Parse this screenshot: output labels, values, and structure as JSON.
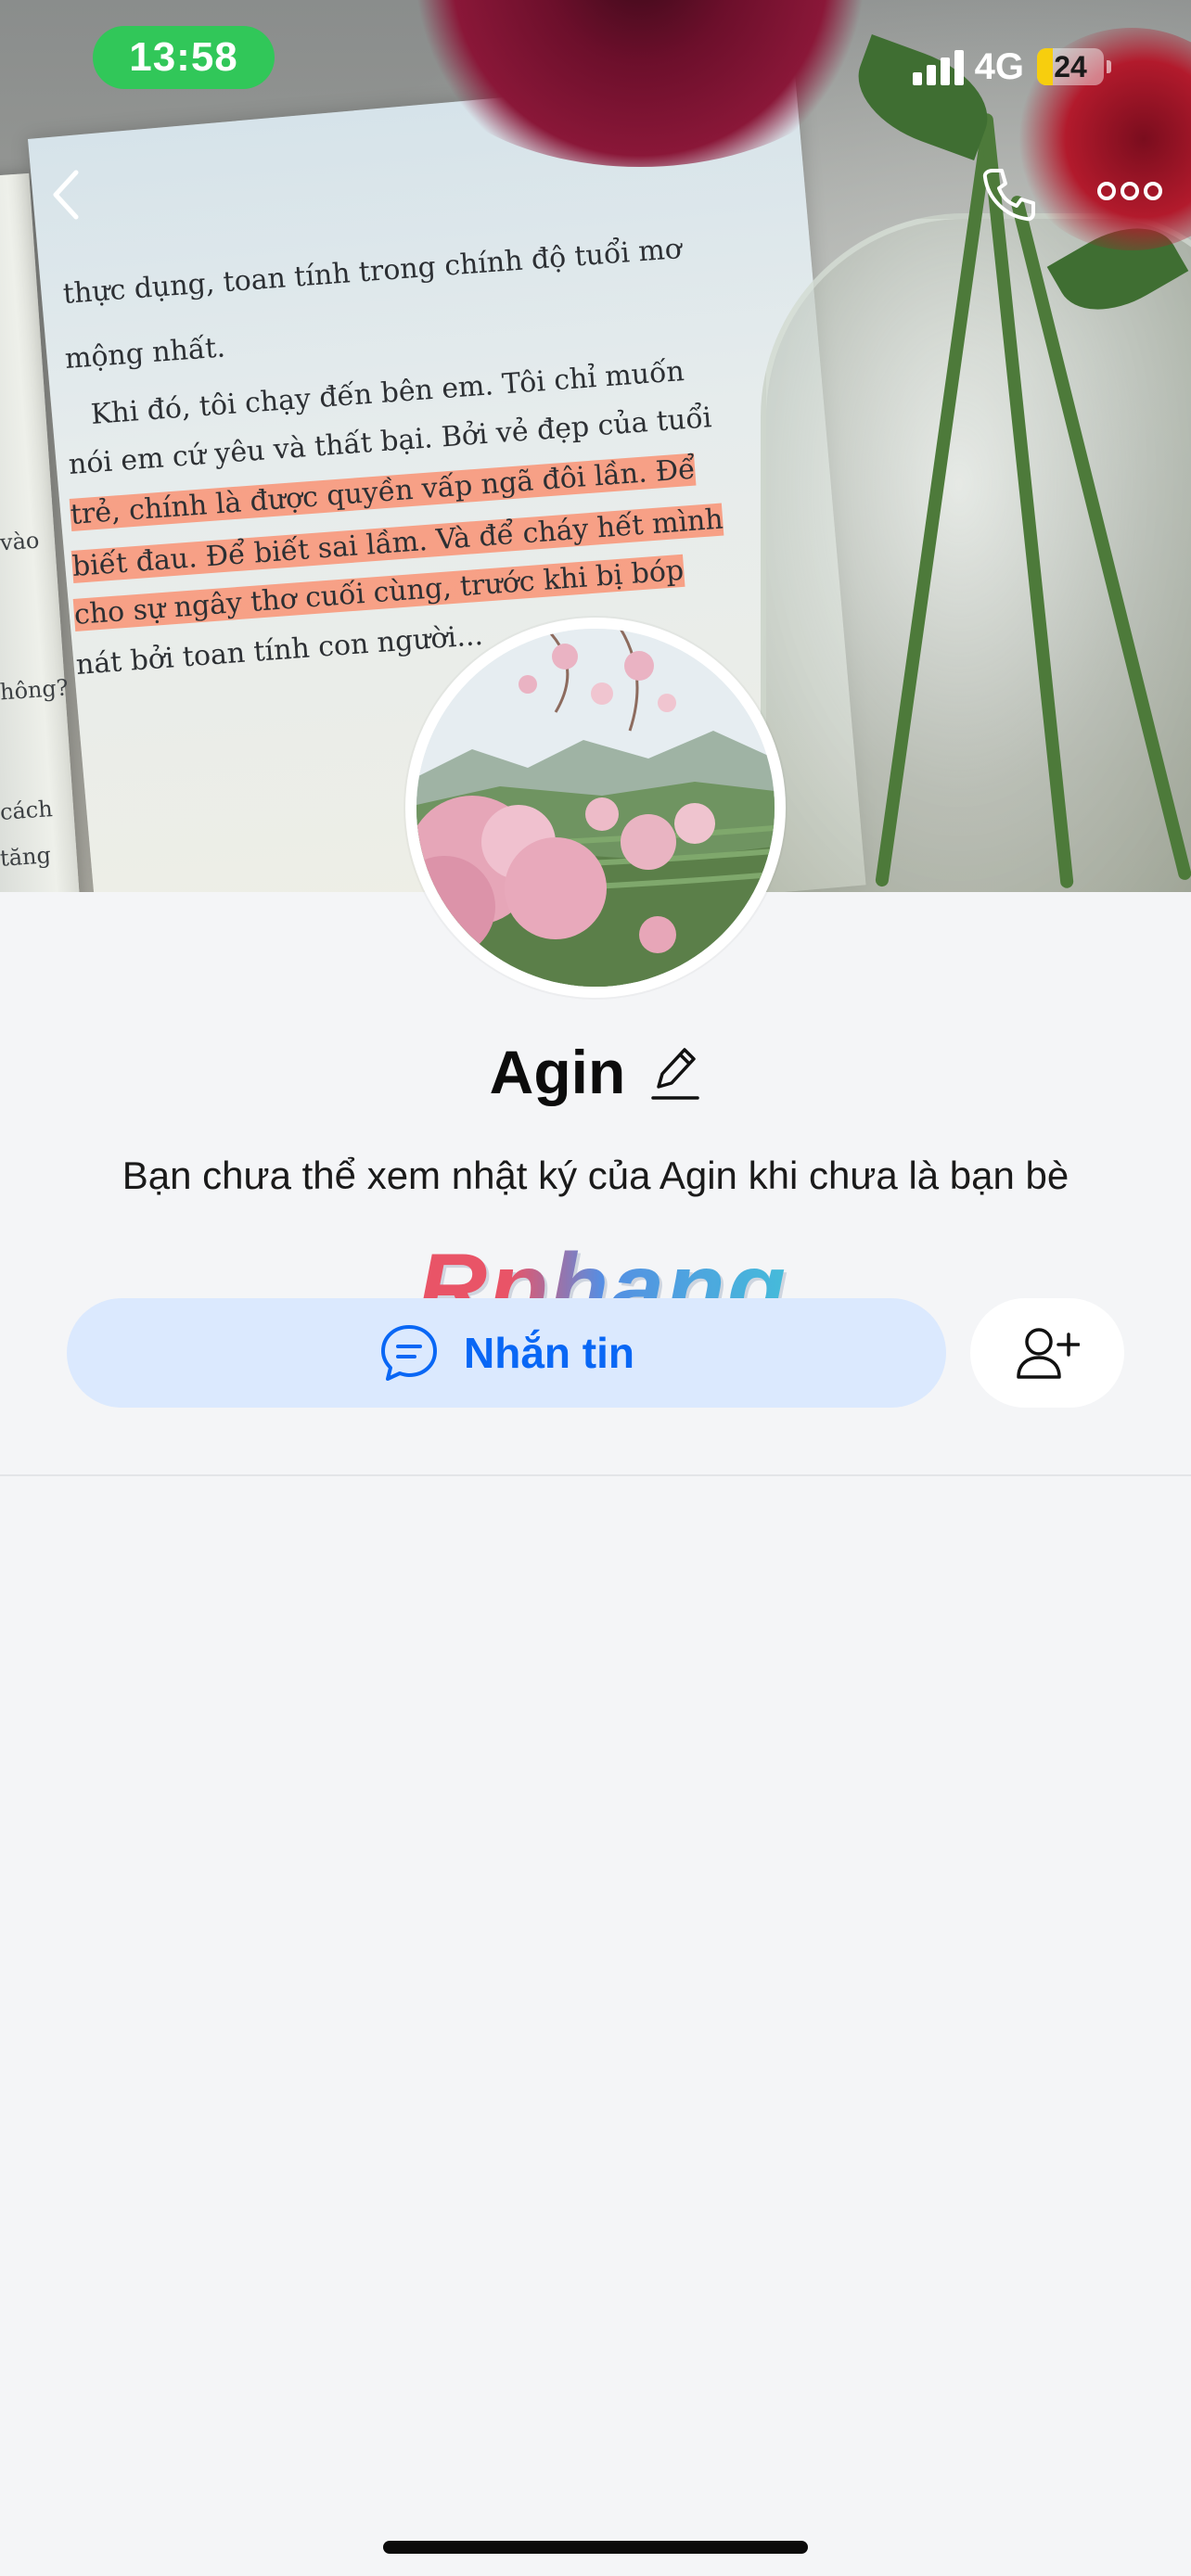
{
  "status_bar": {
    "time": "13:58",
    "network": "4G",
    "battery_level": "24",
    "battery_fill_fraction": 0.24,
    "signal_bars": 4,
    "time_pill_color": "#31c759",
    "battery_color": "#f7ce0e"
  },
  "nav": {
    "back_icon": "chevron-left-icon",
    "call_icon": "phone-icon",
    "more_icon": "more-dots-icon"
  },
  "cover_photo": {
    "book_lines": [
      "thực dụng, toan tính trong chính độ tuổi mơ",
      "mộng nhất.",
      "Khi đó, tôi chạy đến bên em. Tôi chỉ muốn",
      "nói em cứ yêu và thất bại. Bởi vẻ đẹp của tuổi",
      "trẻ, chính là được quyền vấp ngã đôi lần. Để",
      "biết đau. Để biết sai lầm. Và để cháy hết mình",
      "cho sự ngây thơ cuối cùng, trước khi bị bóp",
      "nát bởi toan tính con người..."
    ],
    "side_fragments": [
      "cách",
      "tăng",
      "hông?",
      "vào"
    ]
  },
  "profile": {
    "name": "Agin",
    "edit_icon": "pencil-icon",
    "notice": "Bạn chưa thể xem nhật ký của Agin khi chưa là bạn bè",
    "watermark": "Rphang"
  },
  "actions": {
    "message_label": "Nhắn tin",
    "message_icon": "chat-bubble-icon",
    "add_friend_icon": "add-friend-icon",
    "accent_color": "#0967f5",
    "message_bg": "#dbe9fe"
  }
}
